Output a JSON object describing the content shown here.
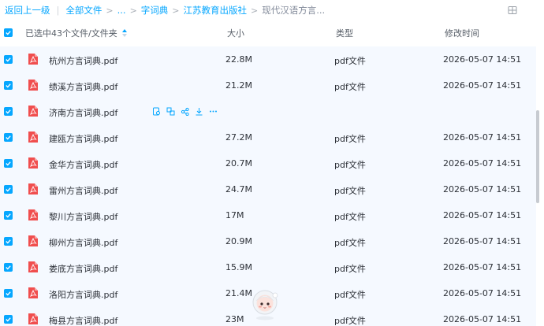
{
  "breadcrumb": {
    "back": "返回上一级",
    "all_files": "全部文件",
    "ellipsis": "...",
    "dict": "字词典",
    "publisher": "江苏教育出版社",
    "current": "现代汉语方言..."
  },
  "header": {
    "selected_text": "已选中43个文件/文件夹",
    "col_size": "大小",
    "col_type": "类型",
    "col_modified": "修改时间"
  },
  "colors": {
    "accent": "#06a7ff",
    "pdf_red": "#f04e4e",
    "row_bg": "#f5f9ff"
  },
  "files": [
    {
      "name": "杭州方言词典.pdf",
      "size": "22.8M",
      "type": "pdf文件",
      "modified": "2026-05-07 14:51"
    },
    {
      "name": "绩溪方言词典.pdf",
      "size": "21.2M",
      "type": "pdf文件",
      "modified": "2026-05-07 14:51"
    },
    {
      "name": "济南方言词典.pdf",
      "size": "",
      "type": "",
      "modified": ""
    },
    {
      "name": "建瓯方言词典.pdf",
      "size": "27.2M",
      "type": "pdf文件",
      "modified": "2026-05-07 14:51"
    },
    {
      "name": "金华方言词典.pdf",
      "size": "20.7M",
      "type": "pdf文件",
      "modified": "2026-05-07 14:51"
    },
    {
      "name": "雷州方言词典.pdf",
      "size": "24.7M",
      "type": "pdf文件",
      "modified": "2026-05-07 14:51"
    },
    {
      "name": "黎川方言词典.pdf",
      "size": "17M",
      "type": "pdf文件",
      "modified": "2026-05-07 14:51"
    },
    {
      "name": "柳州方言词典.pdf",
      "size": "20.9M",
      "type": "pdf文件",
      "modified": "2026-05-07 14:51"
    },
    {
      "name": "娄底方言词典.pdf",
      "size": "15.9M",
      "type": "pdf文件",
      "modified": "2026-05-07 14:51"
    },
    {
      "name": "洛阳方言词典.pdf",
      "size": "21.4M",
      "type": "pdf文件",
      "modified": "2026-05-07 14:51"
    },
    {
      "name": "梅县方言词典.pdf",
      "size": "23M",
      "type": "pdf文件",
      "modified": "2026-05-07 14:51"
    }
  ],
  "row_actions": [
    "preview-icon",
    "share-icon",
    "link-icon",
    "download-icon",
    "more-icon"
  ]
}
